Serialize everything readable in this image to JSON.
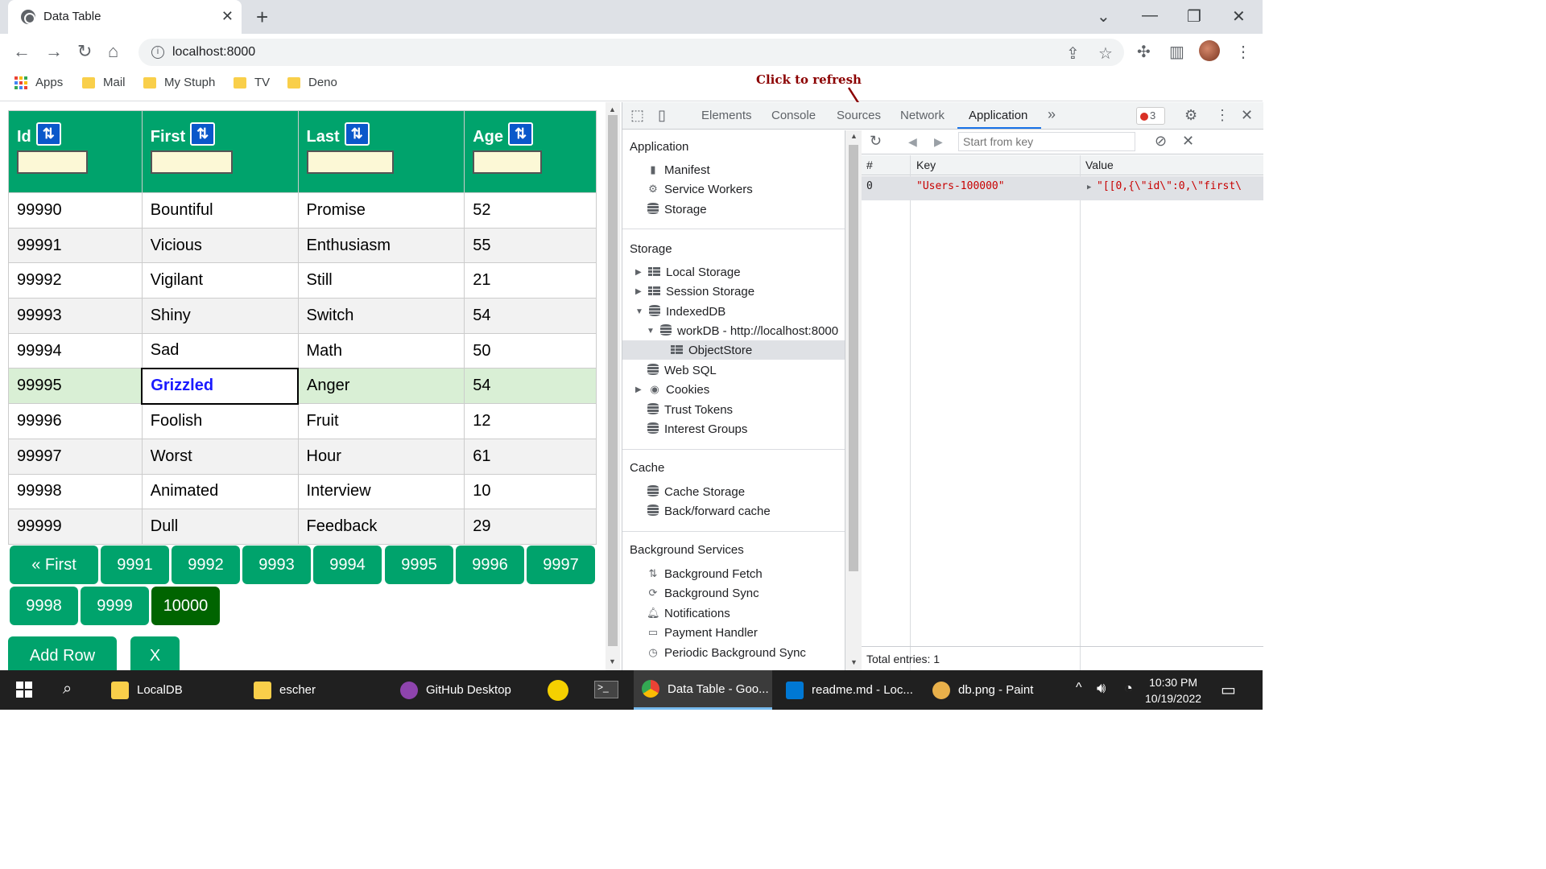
{
  "browser": {
    "tab_title": "Data Table",
    "tab_close": "✕",
    "new_tab": "+",
    "url": "localhost:8000",
    "bookmarks": [
      "Apps",
      "Mail",
      "My Stuph",
      "TV",
      "Deno"
    ]
  },
  "annotation": "Click to refresh",
  "table": {
    "headers": [
      "Id",
      "First",
      "Last",
      "Age"
    ],
    "sort_icon": "⇅",
    "rows": [
      [
        "99990",
        "Bountiful",
        "Promise",
        "52"
      ],
      [
        "99991",
        "Vicious",
        "Enthusiasm",
        "55"
      ],
      [
        "99992",
        "Vigilant",
        "Still",
        "21"
      ],
      [
        "99993",
        "Shiny",
        "Switch",
        "54"
      ],
      [
        "99994",
        "Sad",
        "Math",
        "50"
      ],
      [
        "99995",
        "Grizzled",
        "Anger",
        "54"
      ],
      [
        "99996",
        "Foolish",
        "Fruit",
        "12"
      ],
      [
        "99997",
        "Worst",
        "Hour",
        "61"
      ],
      [
        "99998",
        "Animated",
        "Interview",
        "10"
      ],
      [
        "99999",
        "Dull",
        "Feedback",
        "29"
      ]
    ],
    "selected_row": 5
  },
  "pager": {
    "buttons": [
      "« First",
      "9991",
      "9992",
      "9993",
      "9994",
      "9995",
      "9996",
      "9997",
      "9998",
      "9999",
      "10000"
    ],
    "active": "10000"
  },
  "actions": {
    "add_row": "Add Row",
    "delete": "X"
  },
  "devtools": {
    "tabs": [
      "Elements",
      "Console",
      "Sources",
      "Network",
      "Application"
    ],
    "active_tab": "Application",
    "more": "»",
    "error_count": "3",
    "sidebar": {
      "application_title": "Application",
      "application_items": [
        "Manifest",
        "Service Workers",
        "Storage"
      ],
      "storage_title": "Storage",
      "storage_items": [
        "Local Storage",
        "Session Storage",
        "IndexedDB",
        "workDB - http://localhost:8000",
        "ObjectStore",
        "Web SQL",
        "Cookies",
        "Trust Tokens",
        "Interest Groups"
      ],
      "cache_title": "Cache",
      "cache_items": [
        "Cache Storage",
        "Back/forward cache"
      ],
      "bg_title": "Background Services",
      "bg_items": [
        "Background Fetch",
        "Background Sync",
        "Notifications",
        "Payment Handler",
        "Periodic Background Sync"
      ]
    },
    "store": {
      "key_placeholder": "Start from key",
      "columns": [
        "#",
        "Key",
        "Value"
      ],
      "row": {
        "index": "0",
        "key": "\"Users-100000\"",
        "value": "\"[[0,{\\\"id\\\":0,\\\"first\\"
      },
      "footer": "Total entries: 1"
    }
  },
  "taskbar": {
    "items": [
      "LocalDB",
      "escher",
      "GitHub Desktop",
      "Data Table - Goo...",
      "readme.md - Loc...",
      "db.png - Paint"
    ],
    "time": "10:30 PM",
    "date": "10/19/2022"
  },
  "colors": {
    "table_header": "#00a36c",
    "pager_active": "#006400",
    "annotation": "#8b0000",
    "devtools_accent": "#1a73e8"
  }
}
